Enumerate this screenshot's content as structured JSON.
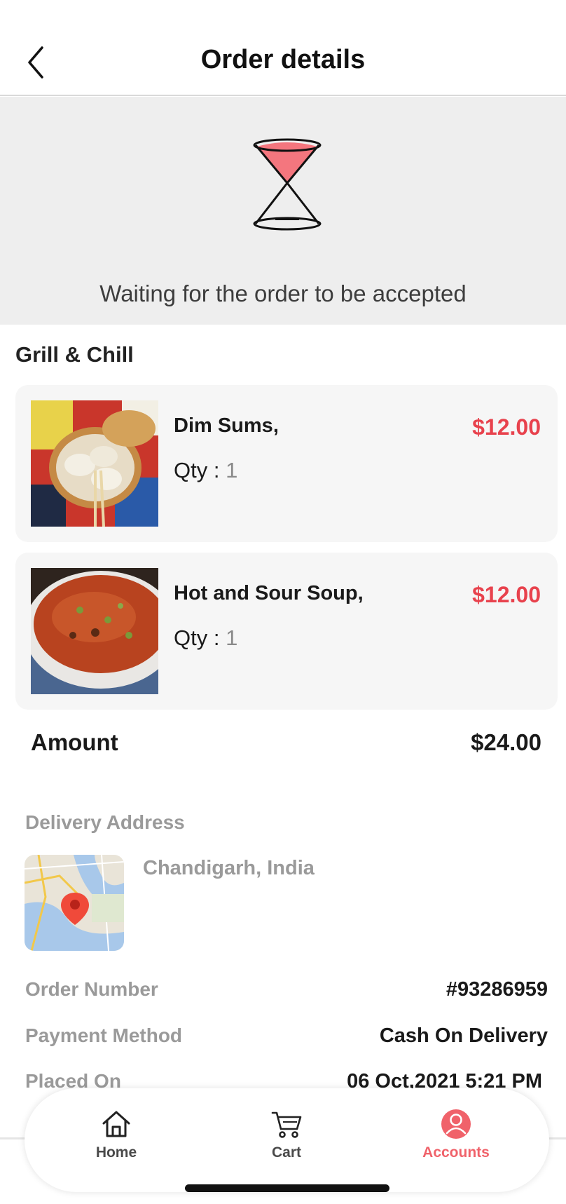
{
  "header": {
    "title": "Order details"
  },
  "status": {
    "message": "Waiting for the order to be accepted"
  },
  "restaurant": {
    "name": "Grill & Chill"
  },
  "items": [
    {
      "name": "Dim Sums,",
      "qty_label": "Qty : ",
      "qty": "1",
      "price": "$12.00"
    },
    {
      "name": "Hot and Sour Soup,",
      "qty_label": "Qty : ",
      "qty": "1",
      "price": "$12.00"
    }
  ],
  "amount": {
    "label": "Amount",
    "value": "$24.00"
  },
  "delivery": {
    "label": "Delivery Address",
    "address": "Chandigarh, India"
  },
  "details": [
    {
      "label": "Order Number",
      "value": "#93286959"
    },
    {
      "label": "Payment Method",
      "value": "Cash On Delivery"
    },
    {
      "label": "Placed On",
      "value": "06 Oct,2021 5:21 PM"
    }
  ],
  "tabs": [
    {
      "label": "Home",
      "icon": "home-icon"
    },
    {
      "label": "Cart",
      "icon": "cart-icon"
    },
    {
      "label": "Accounts",
      "icon": "account-icon",
      "active": true
    }
  ],
  "colors": {
    "accent": "#e8424d",
    "tab_active": "#f0626a",
    "banner_bg": "#eeeeee",
    "card_bg": "#f6f6f6"
  }
}
